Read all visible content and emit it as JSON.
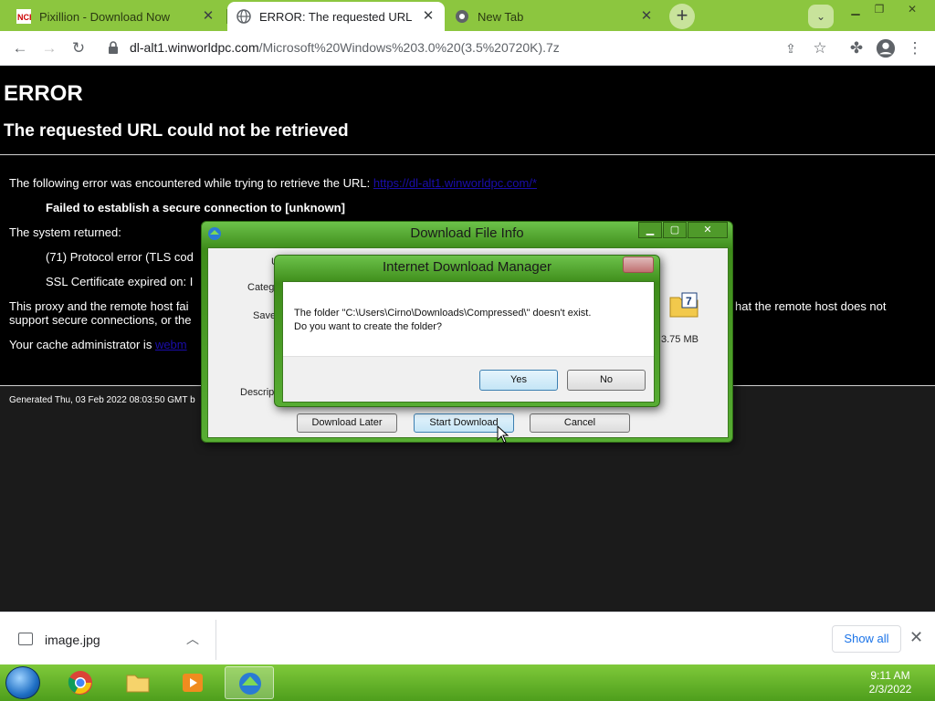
{
  "browser": {
    "tabs": [
      {
        "title": "Pixillion - Download Now",
        "favicon": "nch-logo",
        "active": false
      },
      {
        "title": "ERROR: The requested URL could",
        "favicon": "globe-icon",
        "active": true
      },
      {
        "title": "New Tab",
        "favicon": "chrome-icon",
        "active": false
      }
    ],
    "tab_close": "✕",
    "new_tab": "+",
    "url_host": "dl-alt1.winworldpc.com",
    "url_path": "/Microsoft%20Windows%203.0%20(3.5%20720K).7z"
  },
  "page": {
    "h1": "ERROR",
    "h2": "The requested URL could not be retrieved",
    "line1_prefix": "The following error was encountered while trying to retrieve the URL: ",
    "line1_link": "https://dl-alt1.winworldpc.com/*",
    "line2": "Failed to establish a secure connection to [unknown]",
    "line3": "The system returned:",
    "line4": "(71) Protocol error (TLS cod",
    "line5": "SSL Certificate expired on: I",
    "line6_left": "This proxy and the remote host fai",
    "line6_right": "hat the remote host does not",
    "line7": "support secure connections, or the",
    "line8_prefix": "Your cache administrator is ",
    "line8_link": "webm",
    "footer": "Generated Thu, 03 Feb 2022 08:03:50 GMT b"
  },
  "download_file_info": {
    "title": "Download File Info",
    "label_url": "U",
    "label_category": "Categ",
    "label_save": "Save",
    "label_description": "Descript",
    "size": "3.75 MB",
    "folder_badge": "7",
    "btn_later": "Download Later",
    "btn_start": "Start Download",
    "btn_cancel": "Cancel"
  },
  "idm_dialog": {
    "title": "Internet Download Manager",
    "message_line1": "The folder \"C:\\Users\\Cirno\\Downloads\\Compressed\\\" doesn't exist.",
    "message_line2": "Do you want to create the folder?",
    "btn_yes": "Yes",
    "btn_no": "No"
  },
  "download_shelf": {
    "filename": "image.jpg",
    "show_all": "Show all"
  },
  "taskbar": {
    "time": "9:11 AM",
    "date": "2/3/2022"
  },
  "colors": {
    "theme_green": "#8cc63f",
    "link_blue": "#1a0dab",
    "page_bg": "#000000"
  }
}
